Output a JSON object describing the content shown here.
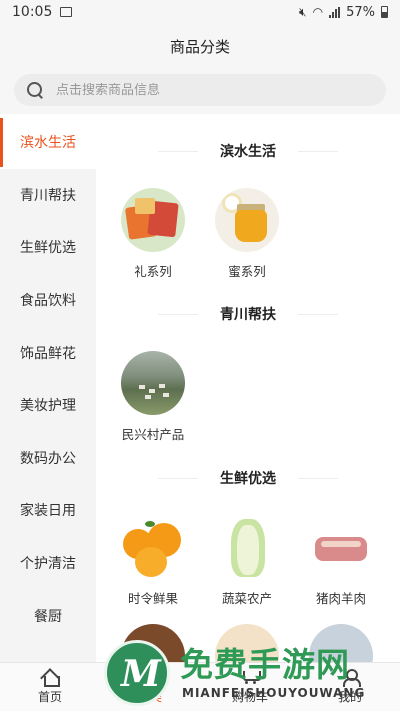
{
  "status_bar": {
    "time": "10:05",
    "battery": "57%"
  },
  "header": {
    "title": "商品分类"
  },
  "search": {
    "placeholder": "点击搜索商品信息"
  },
  "sidebar": {
    "active_color": "#e8531c",
    "items": [
      {
        "label": "滨水生活",
        "active": true
      },
      {
        "label": "青川帮扶"
      },
      {
        "label": "生鲜优选"
      },
      {
        "label": "食品饮料"
      },
      {
        "label": "饰品鲜花"
      },
      {
        "label": "美妆护理"
      },
      {
        "label": "数码办公"
      },
      {
        "label": "家装日用"
      },
      {
        "label": "个护清洁"
      },
      {
        "label": "餐厨"
      }
    ]
  },
  "content": {
    "sections": [
      {
        "title": "滨水生活",
        "items": [
          {
            "label": "礼系列",
            "icon": "gift-box-image"
          },
          {
            "label": "蜜系列",
            "icon": "honey-jar-image"
          }
        ]
      },
      {
        "title": "青川帮扶",
        "items": [
          {
            "label": "民兴村产品",
            "icon": "village-image"
          }
        ]
      },
      {
        "title": "生鲜优选",
        "items": [
          {
            "label": "时令鲜果",
            "icon": "orange-image"
          },
          {
            "label": "蔬菜农产",
            "icon": "cabbage-image"
          },
          {
            "label": "猪肉羊肉",
            "icon": "pork-image"
          }
        ]
      }
    ]
  },
  "tabbar": {
    "items": [
      {
        "label": "首页",
        "icon": "home-icon"
      },
      {
        "label": "分类",
        "icon": "category-icon",
        "active": true
      },
      {
        "label": "购物车",
        "icon": "cart-icon"
      },
      {
        "label": "我的",
        "icon": "user-icon"
      }
    ]
  },
  "watermark": {
    "main": "免费手游网",
    "sub": "MIANFEISHOUYOUWANG"
  }
}
